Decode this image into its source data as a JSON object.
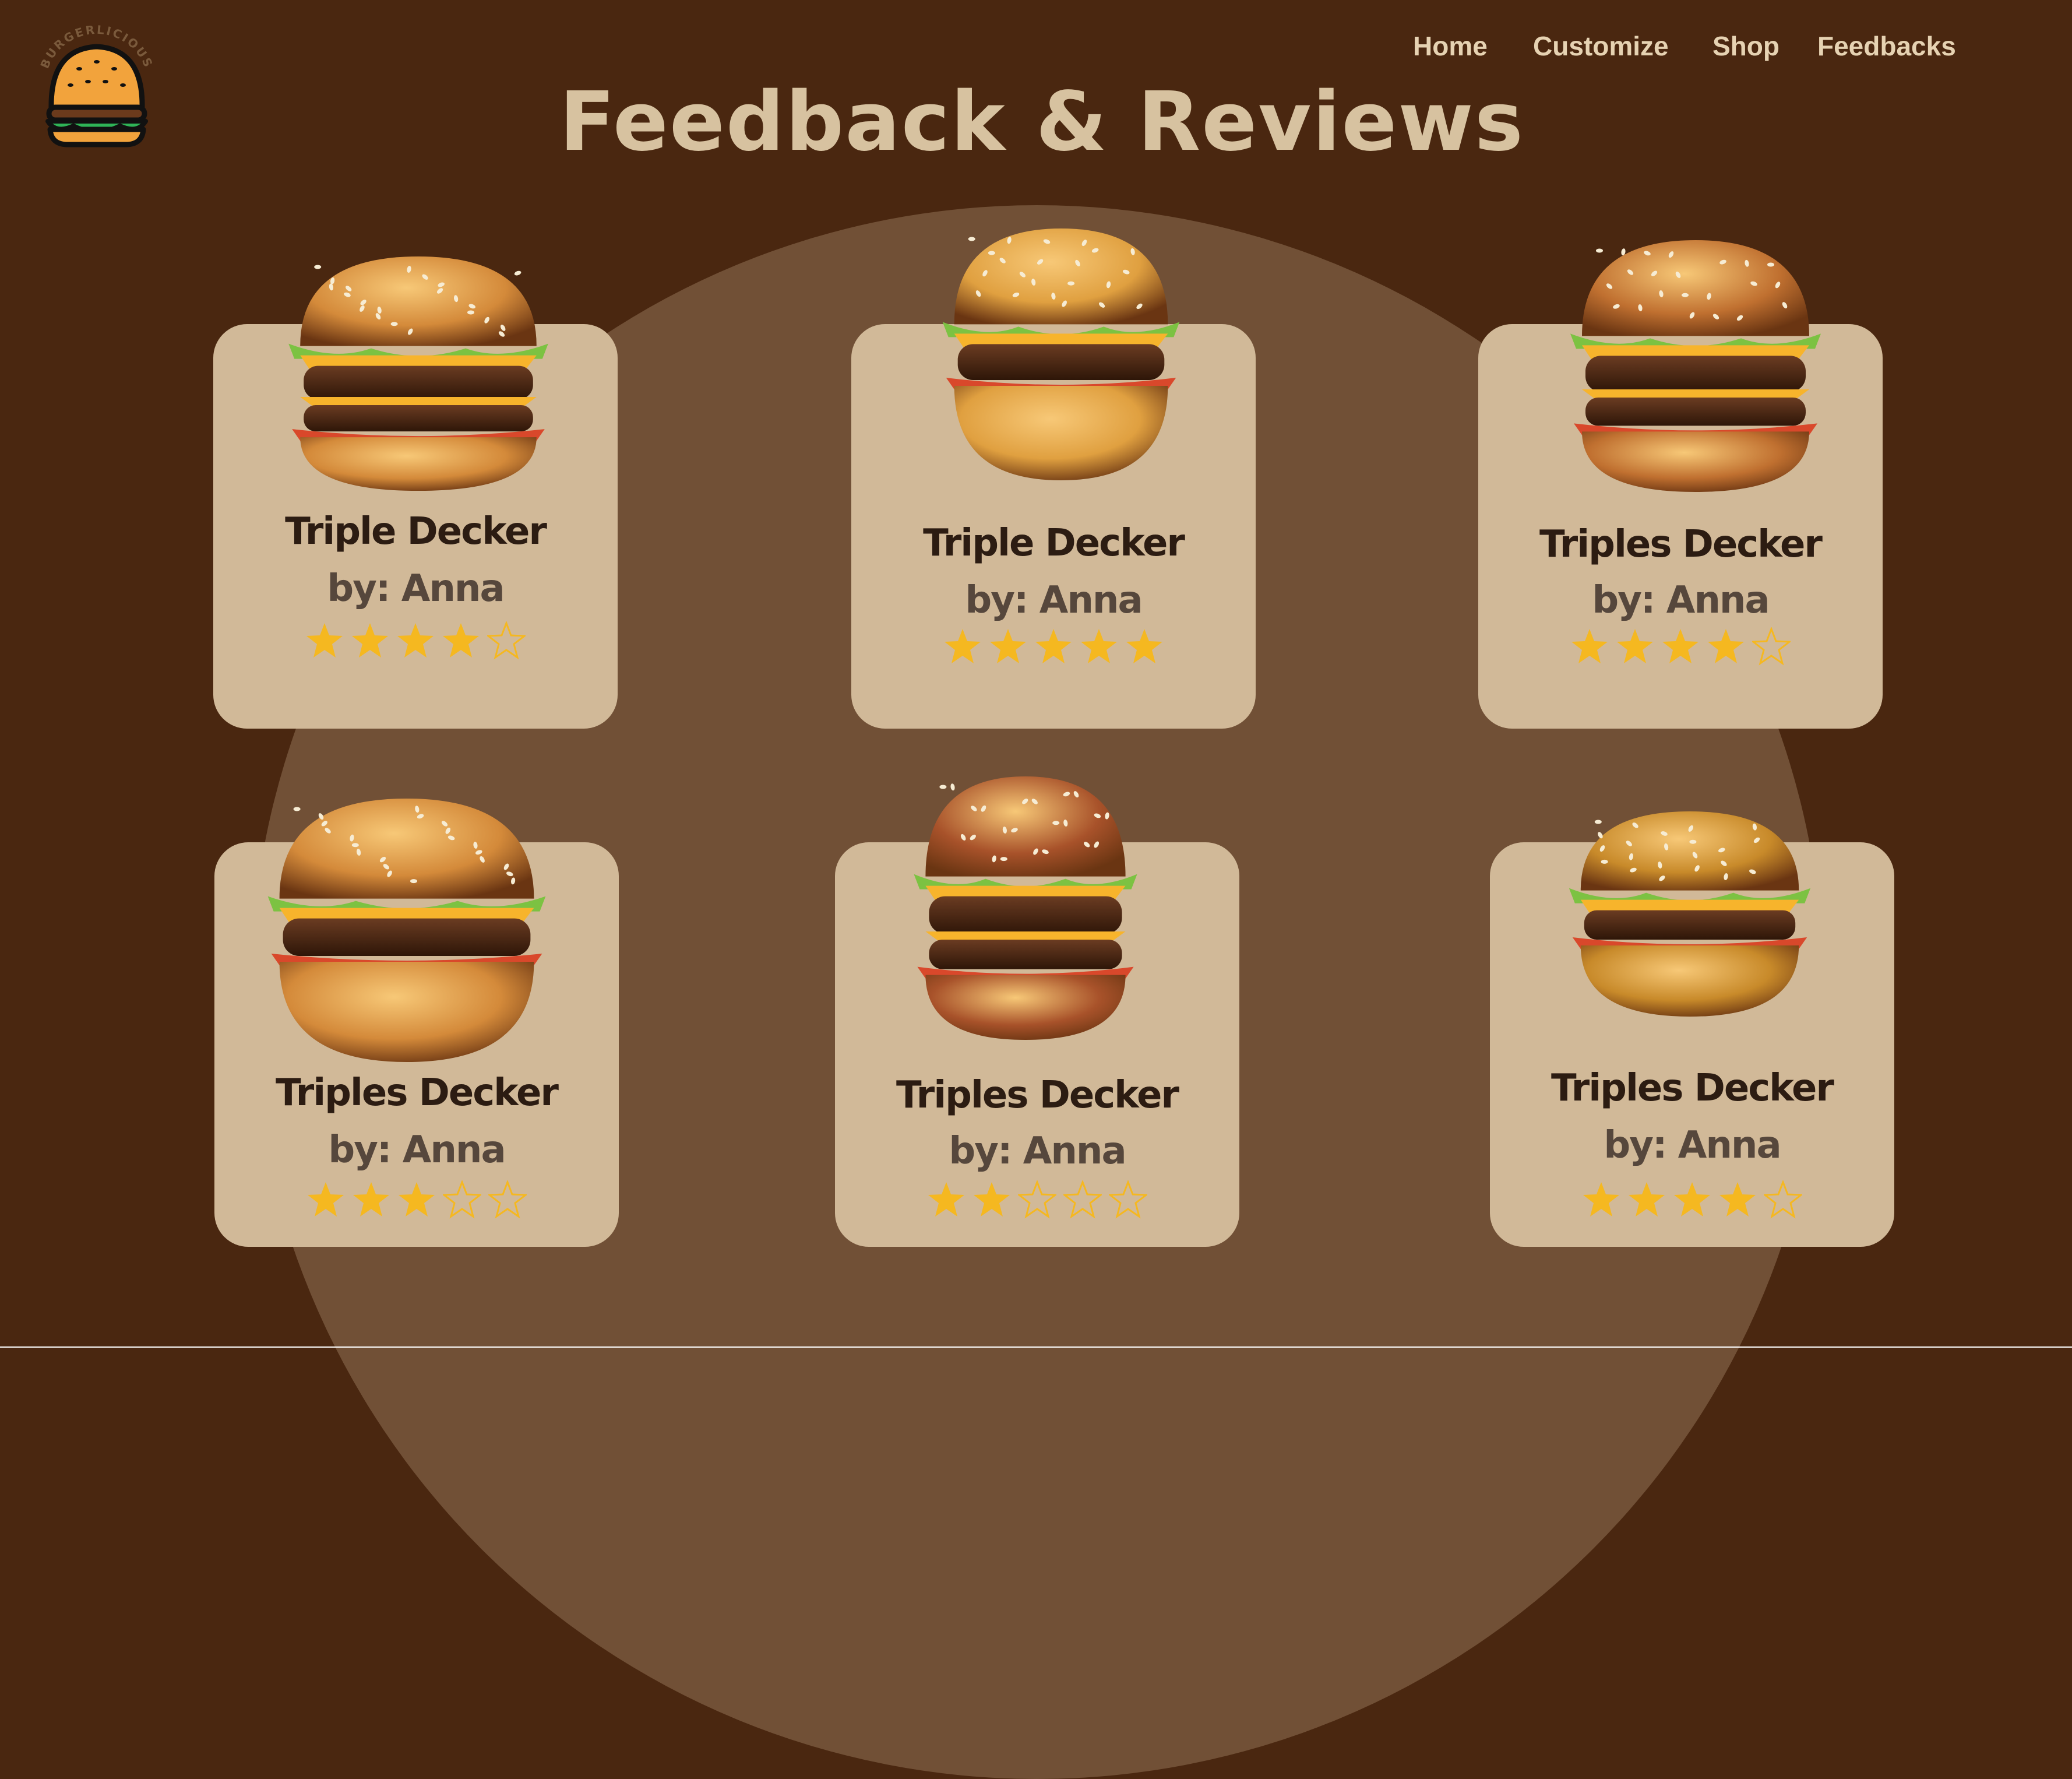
{
  "logo": {
    "brand_text": "BURGERLICIOUS"
  },
  "nav": {
    "items": [
      {
        "label": "Home"
      },
      {
        "label": "Customize"
      },
      {
        "label": "Shop"
      },
      {
        "label": "Feedbacks"
      }
    ]
  },
  "page_title": "Feedback & Reviews",
  "colors": {
    "background": "#4a2710",
    "circle": "#715036",
    "card": "#d1b998",
    "title": "#d7c2a0",
    "nav": "#e6d2b2",
    "star": "#f5b820"
  },
  "reviews": [
    {
      "name": "Triple Decker",
      "author": "by: Anna",
      "rating": 4,
      "max_rating": 5,
      "image_icon": "burger-photo"
    },
    {
      "name": "Triple Decker",
      "author": "by: Anna",
      "rating": 5,
      "max_rating": 5,
      "image_icon": "burger-photo"
    },
    {
      "name": "Triples Decker",
      "author": "by: Anna",
      "rating": 4,
      "max_rating": 5,
      "image_icon": "burger-photo"
    },
    {
      "name": "Triples Decker",
      "author": "by: Anna",
      "rating": 3,
      "max_rating": 5,
      "image_icon": "burger-photo"
    },
    {
      "name": "Triples Decker",
      "author": "by: Anna",
      "rating": 2,
      "max_rating": 5,
      "image_icon": "burger-photo"
    },
    {
      "name": "Triples Decker",
      "author": "by: Anna",
      "rating": 4,
      "max_rating": 5,
      "image_icon": "burger-photo"
    }
  ]
}
